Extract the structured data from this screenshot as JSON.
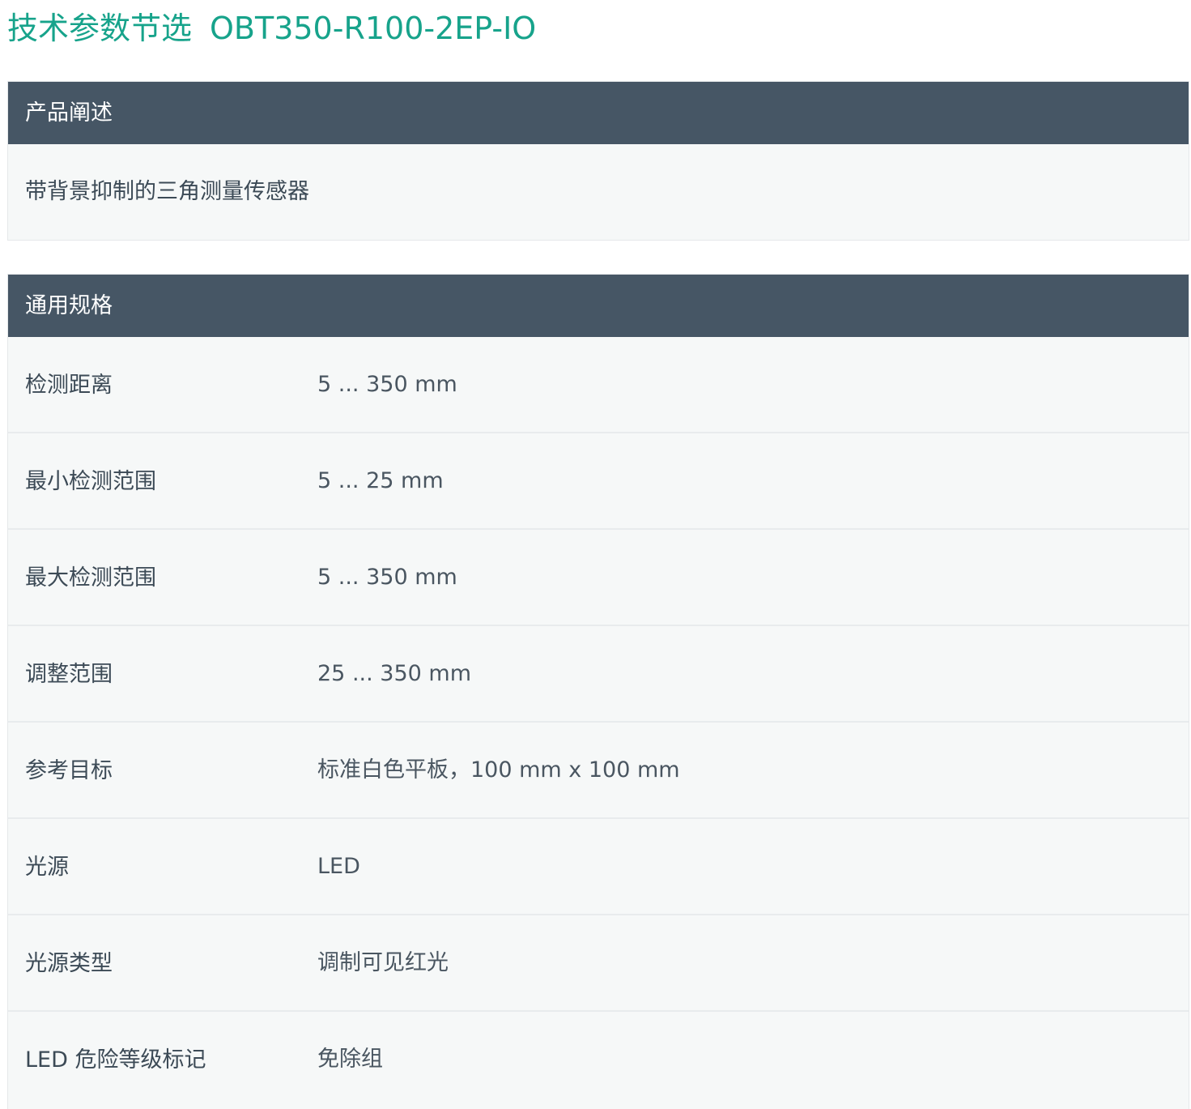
{
  "title": {
    "prefix": "技术参数节选",
    "model": "OBT350-R100-2EP-IO"
  },
  "product_description": {
    "header": "产品阐述",
    "text": "带背景抑制的三角测量传感器"
  },
  "general_specs": {
    "header": "通用规格",
    "rows": [
      {
        "label": "检测距离",
        "value": "5 ... 350 mm"
      },
      {
        "label": "最小检测范围",
        "value": "5 ... 25 mm"
      },
      {
        "label": "最大检测范围",
        "value": "5 ... 350 mm"
      },
      {
        "label": "调整范围",
        "value": "25 ... 350 mm"
      },
      {
        "label": "参考目标",
        "value": "标准白色平板，100 mm x 100 mm"
      },
      {
        "label": "光源",
        "value": "LED"
      },
      {
        "label": "光源类型",
        "value": "调制可见红光"
      },
      {
        "label": "LED 危险等级标记",
        "value": "免除组"
      }
    ]
  },
  "colors": {
    "title": "#17a38b",
    "header_bg": "#465665",
    "panel_bg": "#f6f8f8"
  }
}
